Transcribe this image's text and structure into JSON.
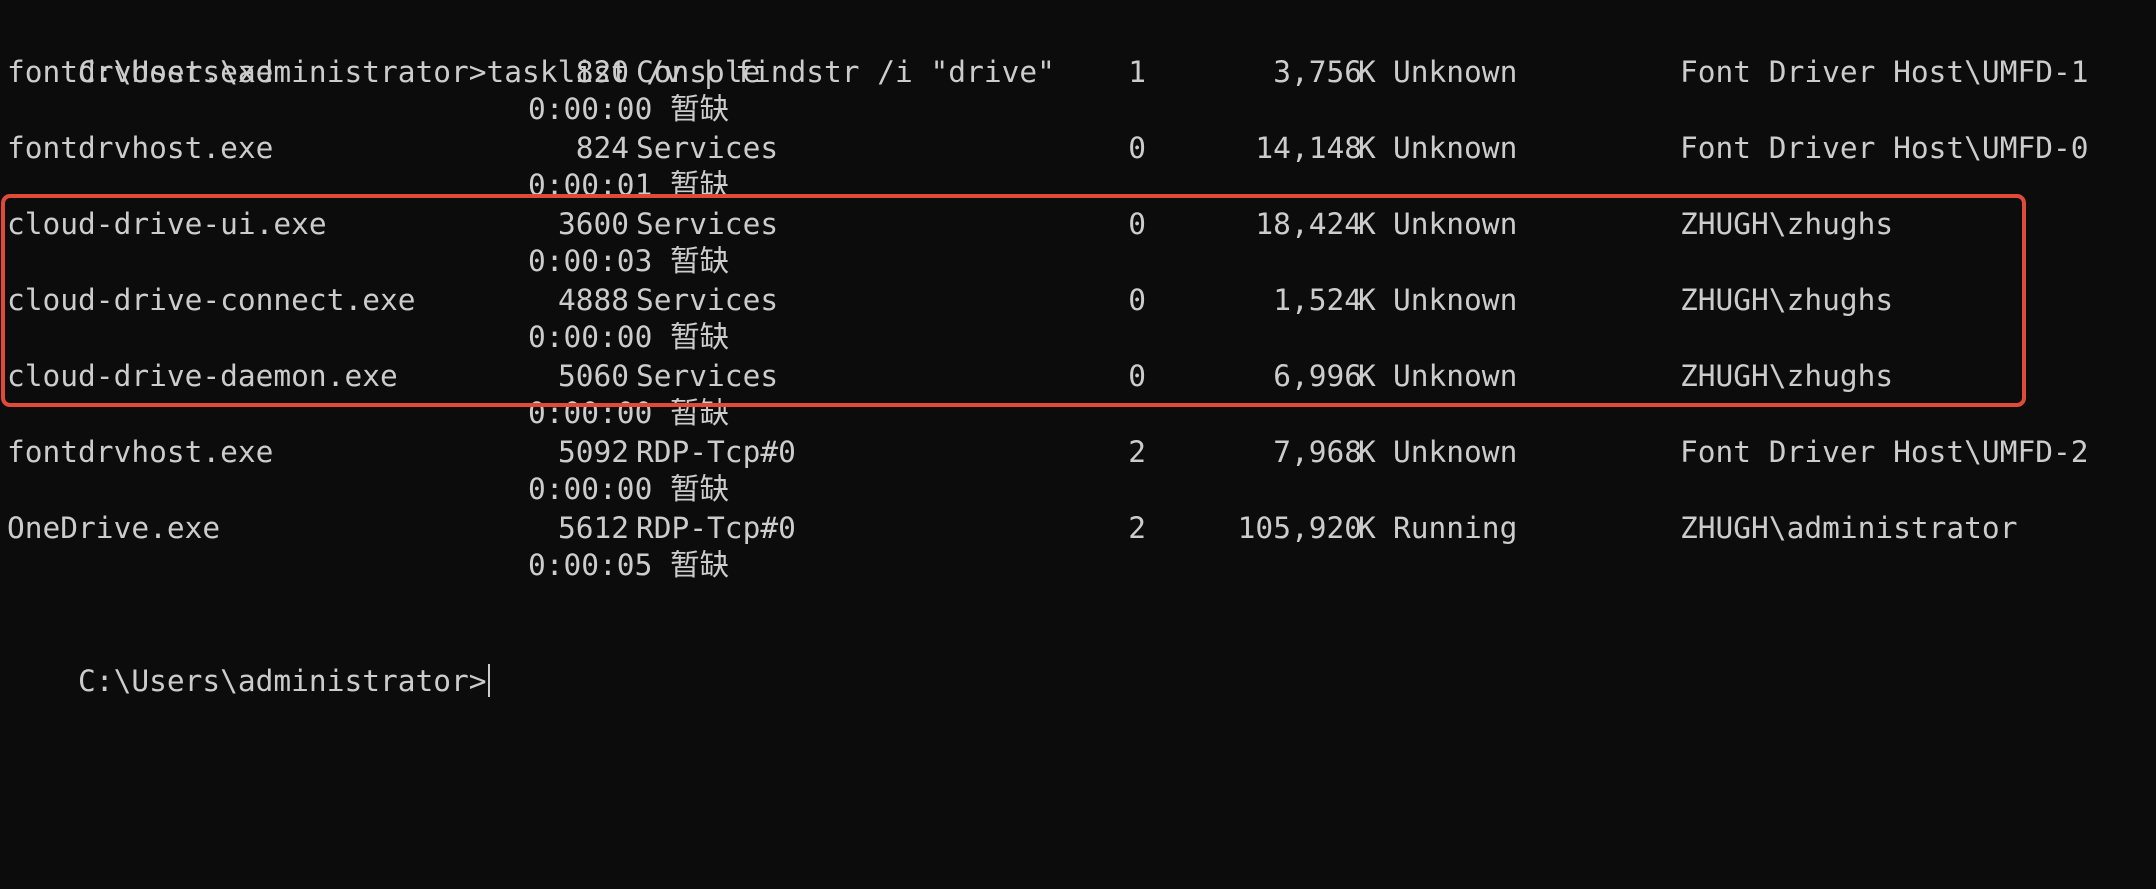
{
  "terminal": {
    "command_line": "C:\\Users\\administrator>tasklist /v | findstr /i \"drive\"",
    "prompt": "C:\\Users\\administrator>",
    "rows": [
      {
        "name": "fontdrvhost.exe",
        "pid": "820",
        "session": "Console",
        "session_num": "1",
        "mem": "3,756",
        "unit": "K",
        "status": "Unknown",
        "user": "Font Driver Host\\UMFD-1",
        "cpu_time": "0:00:00",
        "title": "暂缺"
      },
      {
        "name": "fontdrvhost.exe",
        "pid": "824",
        "session": "Services",
        "session_num": "0",
        "mem": "14,148",
        "unit": "K",
        "status": "Unknown",
        "user": "Font Driver Host\\UMFD-0",
        "cpu_time": "0:00:01",
        "title": "暂缺"
      },
      {
        "name": "cloud-drive-ui.exe",
        "pid": "3600",
        "session": "Services",
        "session_num": "0",
        "mem": "18,424",
        "unit": "K",
        "status": "Unknown",
        "user": "ZHUGH\\zhughs",
        "cpu_time": "0:00:03",
        "title": "暂缺"
      },
      {
        "name": "cloud-drive-connect.exe",
        "pid": "4888",
        "session": "Services",
        "session_num": "0",
        "mem": "1,524",
        "unit": "K",
        "status": "Unknown",
        "user": "ZHUGH\\zhughs",
        "cpu_time": "0:00:00",
        "title": "暂缺"
      },
      {
        "name": "cloud-drive-daemon.exe",
        "pid": "5060",
        "session": "Services",
        "session_num": "0",
        "mem": "6,996",
        "unit": "K",
        "status": "Unknown",
        "user": "ZHUGH\\zhughs",
        "cpu_time": "0:00:00",
        "title": "暂缺"
      },
      {
        "name": "fontdrvhost.exe",
        "pid": "5092",
        "session": "RDP-Tcp#0",
        "session_num": "2",
        "mem": "7,968",
        "unit": "K",
        "status": "Unknown",
        "user": "Font Driver Host\\UMFD-2",
        "cpu_time": "0:00:00",
        "title": "暂缺"
      },
      {
        "name": "OneDrive.exe",
        "pid": "5612",
        "session": "RDP-Tcp#0",
        "session_num": "2",
        "mem": "105,920",
        "unit": "K",
        "status": "Running",
        "user": "ZHUGH\\administrator",
        "cpu_time": "0:00:05",
        "title": "暂缺"
      }
    ]
  },
  "colors": {
    "background": "#0c0c0c",
    "text": "#cccccc",
    "highlight_border": "#e04b38"
  }
}
